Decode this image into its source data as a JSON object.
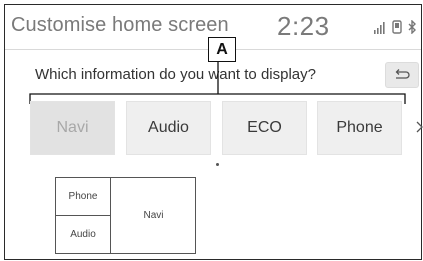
{
  "header": {
    "title": "Customise home screen",
    "clock": "2:23",
    "status_icons": [
      "signal-strength-icon",
      "phone-icon",
      "bluetooth-icon"
    ]
  },
  "callout": {
    "label": "A"
  },
  "prompt": {
    "question": "Which information do you want to display?"
  },
  "options": [
    {
      "label": "Navi",
      "state": "disabled"
    },
    {
      "label": "Audio",
      "state": "enabled"
    },
    {
      "label": "ECO",
      "state": "enabled"
    },
    {
      "label": "Phone",
      "state": "enabled"
    }
  ],
  "layout_preview": {
    "top_left": "Phone",
    "bottom_left": "Audio",
    "right": "Navi"
  },
  "colors": {
    "option_bg": "#efefef",
    "option_disabled_bg": "#e2e2e2",
    "option_disabled_text": "#a8a8a8",
    "header_text": "#7a7a7a"
  }
}
